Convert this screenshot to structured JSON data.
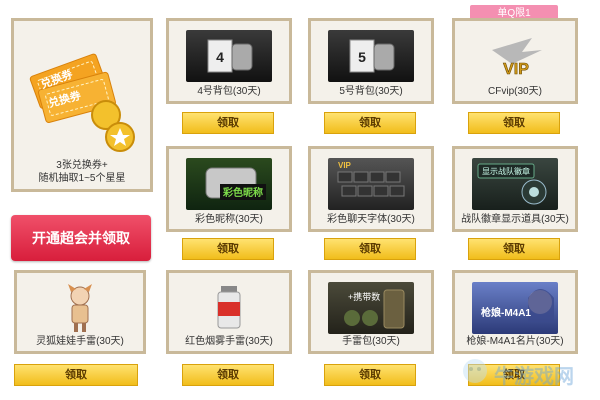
{
  "left": {
    "description_line1": "3张兑换券+",
    "description_line2": "随机抽取1~5个星星",
    "ticket_text_1": "兑换券",
    "ticket_text_2": "兑换券",
    "vip_button": "开通超会并领取"
  },
  "tag_label": "单Q限1",
  "claim_label": "领取",
  "items": [
    {
      "name": "4号背包(30天)",
      "thumb_text": "4"
    },
    {
      "name": "5号背包(30天)",
      "thumb_text": "5"
    },
    {
      "name": "CFvip(30天)",
      "thumb_text": "VIP"
    },
    {
      "name": "彩色昵称(30天)",
      "thumb_text": "彩色昵称"
    },
    {
      "name": "彩色聊天字体(30天)",
      "thumb_text": "VIP"
    },
    {
      "name": "战队徽章显示道具(30天)",
      "thumb_text": "显示战队徽章"
    },
    {
      "name": "灵狐娃娃手雷(30天)",
      "thumb_text": ""
    },
    {
      "name": "红色烟雾手雷(30天)",
      "thumb_text": ""
    },
    {
      "name": "手雷包(30天)",
      "thumb_text": "+携带数"
    },
    {
      "name": "枪娘-M4A1名片(30天)",
      "thumb_text": "枪娘-M4A1"
    }
  ],
  "watermark": "牛游戏网"
}
